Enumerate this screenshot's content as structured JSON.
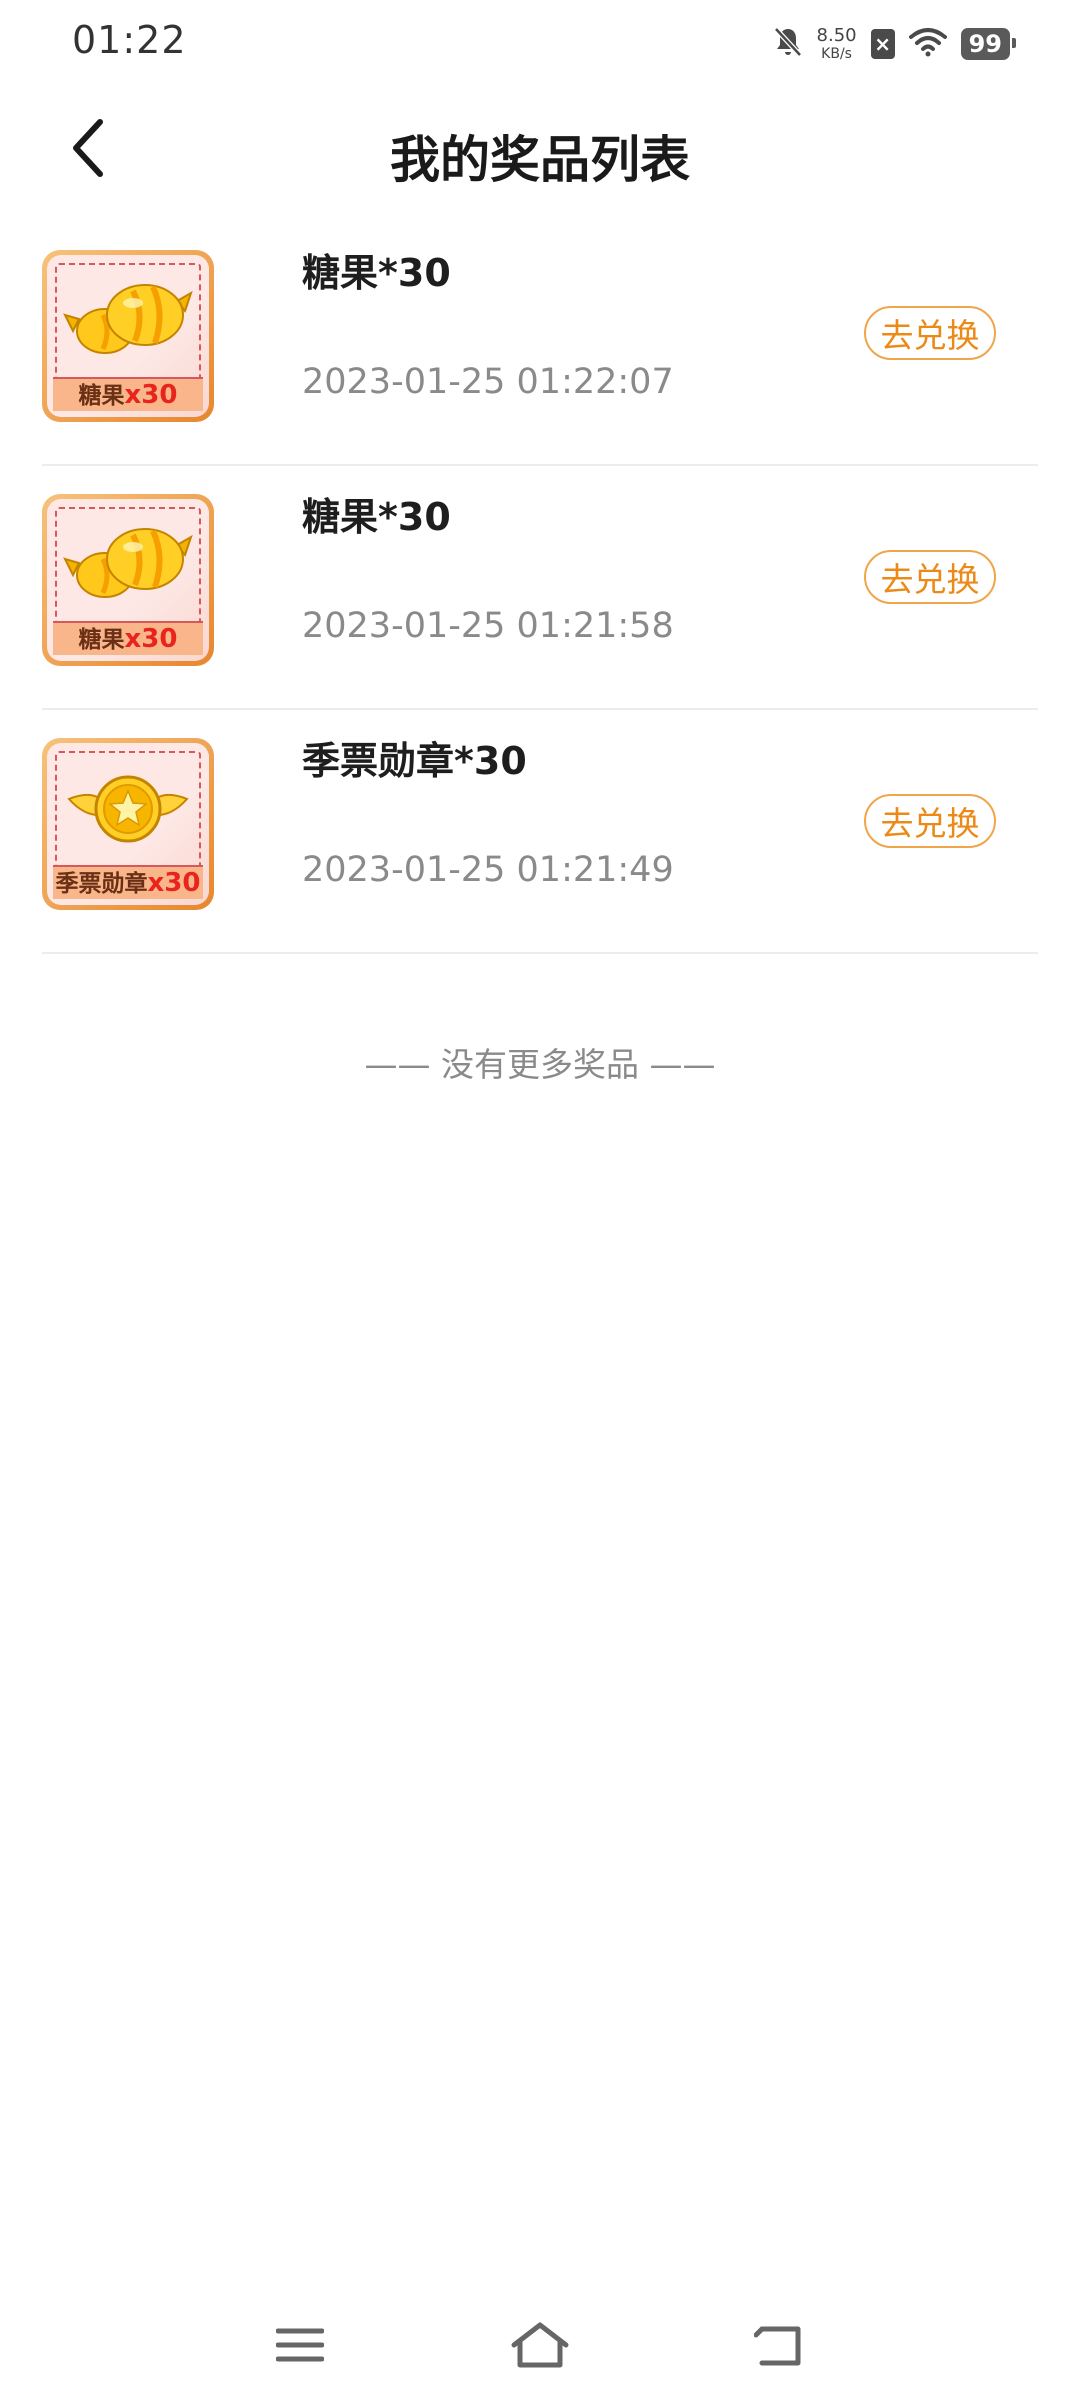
{
  "status_bar": {
    "time": "01:22",
    "net_speed_value": "8.50",
    "net_speed_unit": "KB/s",
    "battery": "99"
  },
  "header": {
    "title": "我的奖品列表"
  },
  "prizes": [
    {
      "name": "糖果*30",
      "time": "2023-01-25 01:22:07",
      "thumb_label": "糖果",
      "thumb_qty": "x30",
      "thumb_icon": "candy-icon",
      "button": "去兑换"
    },
    {
      "name": "糖果*30",
      "time": "2023-01-25 01:21:58",
      "thumb_label": "糖果",
      "thumb_qty": "x30",
      "thumb_icon": "candy-icon",
      "button": "去兑换"
    },
    {
      "name": "季票勋章*30",
      "time": "2023-01-25 01:21:49",
      "thumb_label": "季票勋章",
      "thumb_qty": "x30",
      "thumb_icon": "star-medal-icon",
      "button": "去兑换"
    }
  ],
  "end_note": "—— 没有更多奖品 ——",
  "colors": {
    "accent": "#ec8a18",
    "qty_red": "#e8241c",
    "thumb_border": "#e8862e"
  }
}
